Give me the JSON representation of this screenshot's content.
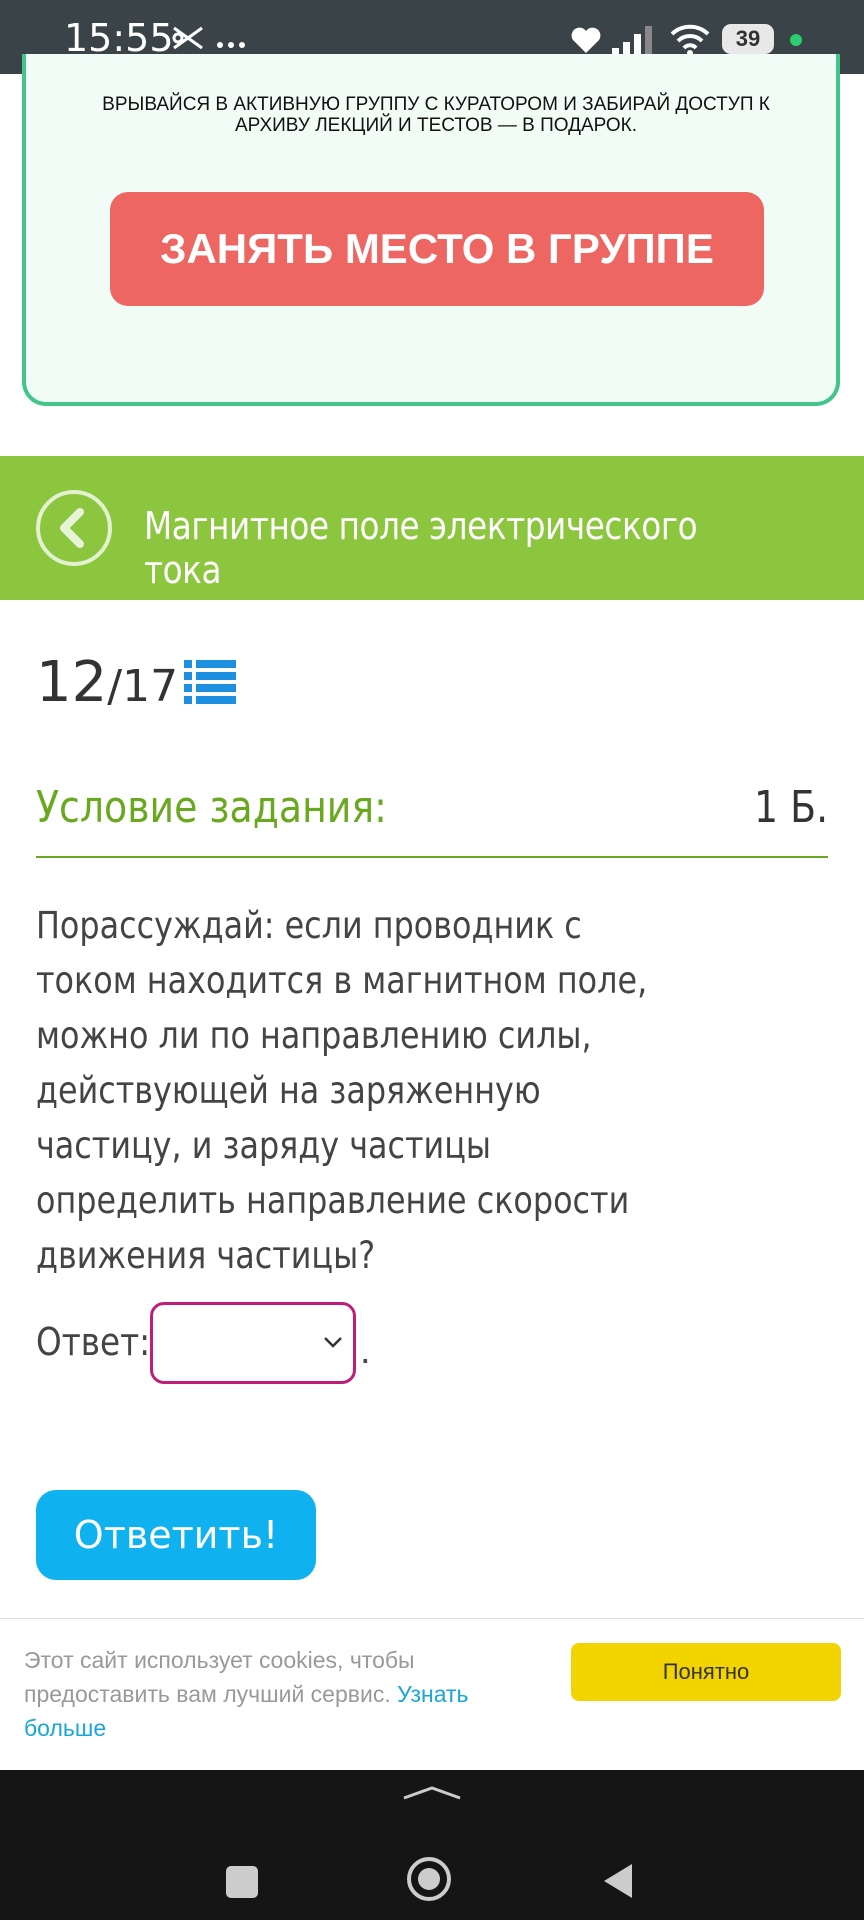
{
  "status_bar": {
    "time": "15:55",
    "battery": "39",
    "accent_dot_color": "#2ecc71",
    "icons": [
      "scissors-icon",
      "more-dots-icon",
      "heart-icon",
      "signal-icon",
      "wifi-icon",
      "battery-icon"
    ]
  },
  "promo": {
    "text": "ВРЫВАЙСЯ В АКТИВНУЮ ГРУППУ С КУРАТОРОМ И ЗАБИРАЙ ДОСТУП К АРХИВУ ЛЕКЦИЙ И ТЕСТОВ — В ПОДАРОК.",
    "button_label": "ЗАНЯТЬ МЕСТО В ГРУППЕ",
    "button_color": "#ee6662",
    "border_color": "#43c48a"
  },
  "topic": {
    "title": "Магнитное поле электрического тока",
    "bar_color": "#8cc63f"
  },
  "task": {
    "current": "12",
    "total": "/17",
    "condition_title": "Условие задания:",
    "points": "1 Б.",
    "question_line1": "Порассуждай: если проводник с",
    "question_rest": "током находится в магнитном поле, можно ли по направлению силы, действующей на заряженную частицу, и заряду частицы определить направление скорости движения частицы?",
    "answer_label": "Ответ:",
    "answer_value": "",
    "answer_suffix": ".",
    "submit_label": "Ответить!"
  },
  "cookie": {
    "text": "Этот сайт использует cookies, чтобы предоставить вам лучший сервис.",
    "link": "Узнать больше",
    "button_label": "Понятно"
  }
}
